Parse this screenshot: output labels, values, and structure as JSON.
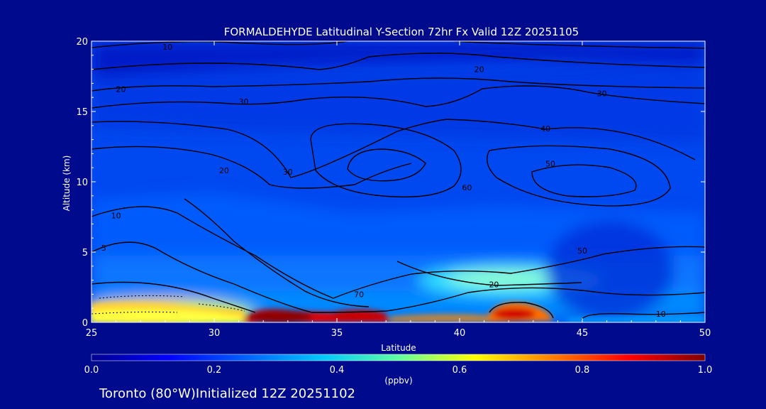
{
  "chart_data": {
    "type": "heatmap",
    "title": "FORMALDEHYDE Latitudinal Y-Section 72hr  Fx Valid 12Z 20251105",
    "xlabel": "Latitude",
    "ylabel": "Altitude (km)",
    "xlim": [
      25,
      50
    ],
    "ylim": [
      0,
      20
    ],
    "x_ticks": [
      "25",
      "30",
      "35",
      "40",
      "45",
      "50"
    ],
    "y_ticks": [
      "0",
      "5",
      "10",
      "15",
      "20"
    ],
    "colorbar": {
      "label": "(ppbv)",
      "range": [
        0.0,
        1.0
      ],
      "ticks": [
        "0.0",
        "0.2",
        "0.4",
        "0.6",
        "0.8",
        "1.0"
      ],
      "colormap": [
        "#00008f",
        "#0000ff",
        "#0060ff",
        "#00c8ff",
        "#60ffa0",
        "#ffff00",
        "#ff8000",
        "#ff0000",
        "#800000"
      ]
    },
    "field_features": [
      {
        "lat": 27,
        "alt": 0.6,
        "value": 0.62
      },
      {
        "lat": 29.5,
        "alt": 0.6,
        "value": 0.58
      },
      {
        "lat": 33,
        "alt": 0.3,
        "value": 0.95
      },
      {
        "lat": 36,
        "alt": 0.4,
        "value": 0.92
      },
      {
        "lat": 39,
        "alt": 3.3,
        "value": 0.42
      },
      {
        "lat": 42,
        "alt": 0.6,
        "value": 0.8
      },
      {
        "lat": 47,
        "alt": 0.3,
        "value": 0.28
      }
    ],
    "contour_labels": [
      {
        "text": "10",
        "lat": 28.1,
        "alt": 19.6
      },
      {
        "text": "20",
        "lat": 26.2,
        "alt": 16.6
      },
      {
        "text": "30",
        "lat": 31.2,
        "alt": 15.7
      },
      {
        "text": "20",
        "lat": 40.8,
        "alt": 18.0
      },
      {
        "text": "30",
        "lat": 45.8,
        "alt": 16.3
      },
      {
        "text": "40",
        "lat": 43.5,
        "alt": 13.8
      },
      {
        "text": "50",
        "lat": 43.7,
        "alt": 11.3
      },
      {
        "text": "60",
        "lat": 40.3,
        "alt": 9.6
      },
      {
        "text": "30",
        "lat": 33.0,
        "alt": 10.7
      },
      {
        "text": "20",
        "lat": 30.4,
        "alt": 10.8
      },
      {
        "text": "10",
        "lat": 26.0,
        "alt": 7.6
      },
      {
        "text": "5",
        "lat": 25.5,
        "alt": 5.3
      },
      {
        "text": "50",
        "lat": 45.0,
        "alt": 5.1
      },
      {
        "text": "20",
        "lat": 41.4,
        "alt": 2.7
      },
      {
        "text": "70",
        "lat": 35.9,
        "alt": 2.0
      },
      {
        "text": "10",
        "lat": 48.2,
        "alt": 0.6
      }
    ]
  },
  "footer": {
    "location": "Toronto (80°W)",
    "initialized": "Initialized 12Z 20251102"
  }
}
